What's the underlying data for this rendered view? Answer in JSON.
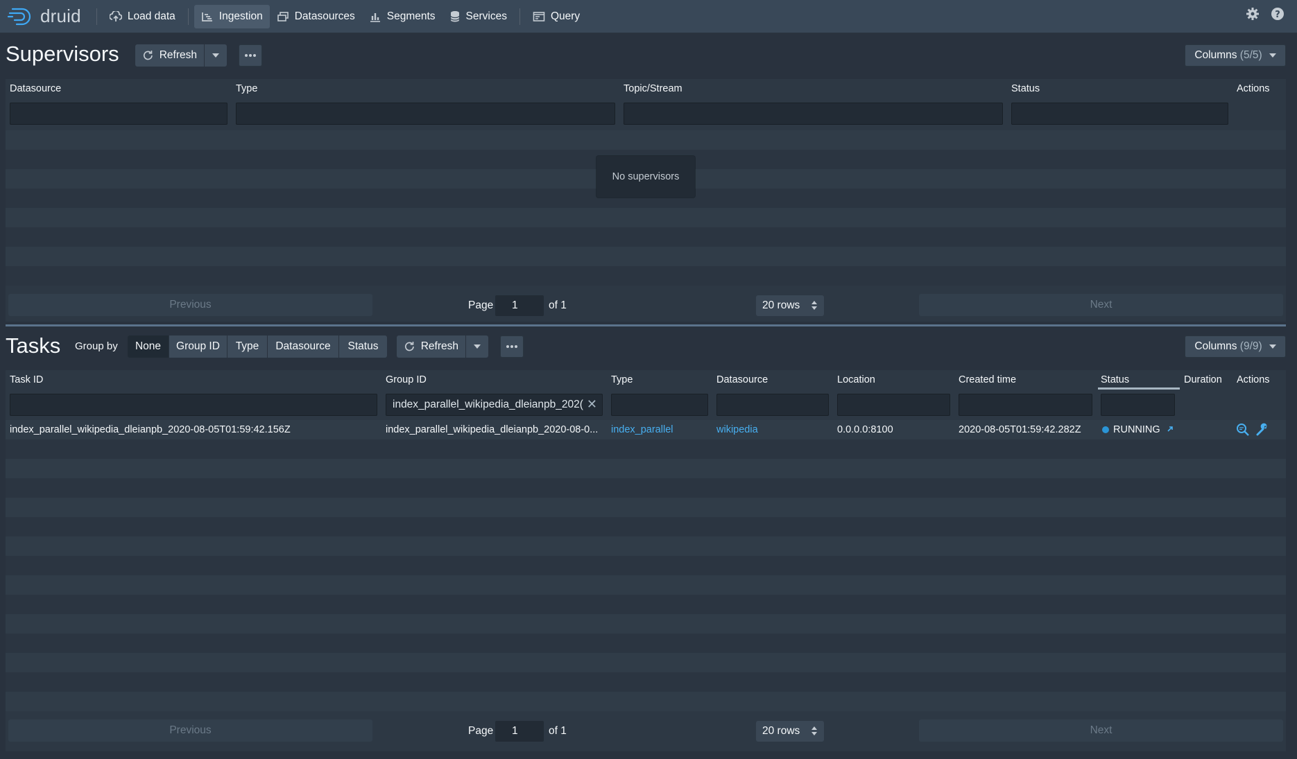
{
  "nav": {
    "brand": "druid",
    "items": [
      {
        "label": "Load data"
      },
      {
        "label": "Ingestion"
      },
      {
        "label": "Datasources"
      },
      {
        "label": "Segments"
      },
      {
        "label": "Services"
      },
      {
        "label": "Query"
      }
    ],
    "active": "Ingestion"
  },
  "supervisors": {
    "title": "Supervisors",
    "refresh_label": "Refresh",
    "columns_label": "Columns",
    "columns_count": "(5/5)",
    "headers": [
      "Datasource",
      "Type",
      "Topic/Stream",
      "Status",
      "Actions"
    ],
    "empty_message": "No supervisors",
    "pager": {
      "previous": "Previous",
      "next": "Next",
      "page_label": "Page",
      "page": "1",
      "of": "of 1",
      "rows": "20 rows"
    }
  },
  "tasks": {
    "title": "Tasks",
    "group_by_label": "Group by",
    "group_by_options": [
      "None",
      "Group ID",
      "Type",
      "Datasource",
      "Status"
    ],
    "group_by_selected": "None",
    "refresh_label": "Refresh",
    "columns_label": "Columns",
    "columns_count": "(9/9)",
    "headers": [
      "Task ID",
      "Group ID",
      "Type",
      "Datasource",
      "Location",
      "Created time",
      "Status",
      "Duration",
      "Actions"
    ],
    "group_id_filter": "index_parallel_wikipedia_dleianpb_202(",
    "rows": [
      {
        "task_id": "index_parallel_wikipedia_dleianpb_2020-08-05T01:59:42.156Z",
        "group_id": "index_parallel_wikipedia_dleianpb_2020-08-0...",
        "type": "index_parallel",
        "datasource": "wikipedia",
        "location": "0.0.0.0:8100",
        "created_time": "2020-08-05T01:59:42.282Z",
        "status": "RUNNING",
        "duration": ""
      }
    ],
    "pager": {
      "previous": "Previous",
      "next": "Next",
      "page_label": "Page",
      "page": "1",
      "of": "of 1",
      "rows": "20 rows"
    }
  },
  "colors": {
    "background": "#29323e",
    "navbar": "#394858",
    "link": "#48aff0",
    "running": "#2b95d6"
  }
}
